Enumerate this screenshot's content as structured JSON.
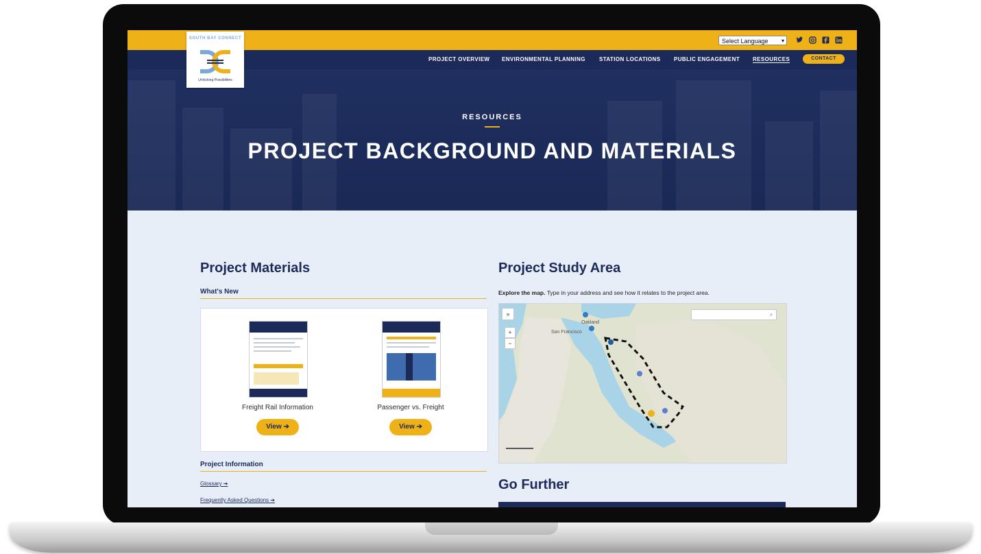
{
  "header": {
    "language_select": "Select Language",
    "social_icons": [
      "twitter-icon",
      "instagram-icon",
      "facebook-icon",
      "linkedin-icon"
    ],
    "logo": {
      "name_line": "SOUTH BAY CONNECT",
      "tagline": "Unlocking Possibilities"
    },
    "nav": [
      "PROJECT OVERVIEW",
      "ENVIRONMENTAL PLANNING",
      "STATION LOCATIONS",
      "PUBLIC ENGAGEMENT",
      "RESOURCES"
    ],
    "contact_label": "CONTACT"
  },
  "hero": {
    "eyebrow": "RESOURCES",
    "title": "PROJECT BACKGROUND AND MATERIALS"
  },
  "materials": {
    "heading": "Project Materials",
    "whats_new": "What's New",
    "cards": [
      {
        "label": "Freight Rail Information",
        "button": "View ➔"
      },
      {
        "label": "Passenger vs. Freight",
        "button": "View ➔"
      }
    ],
    "project_info_heading": "Project Information",
    "links": [
      "Glossary ➔",
      "Frequently Asked Questions ➔"
    ]
  },
  "study_area": {
    "heading": "Project Study Area",
    "intro_bold": "Explore the map.",
    "intro_rest": " Type in your address and see how it relates to the project area.",
    "map_controls": {
      "expand": "»",
      "zoom_in": "+",
      "zoom_out": "−"
    },
    "map_labels": [
      "San Francisco",
      "Oakland"
    ]
  },
  "go_further": {
    "heading": "Go Further"
  },
  "colors": {
    "navy": "#1c2a5a",
    "gold": "#efb118",
    "light_bg": "#e8eef8"
  }
}
